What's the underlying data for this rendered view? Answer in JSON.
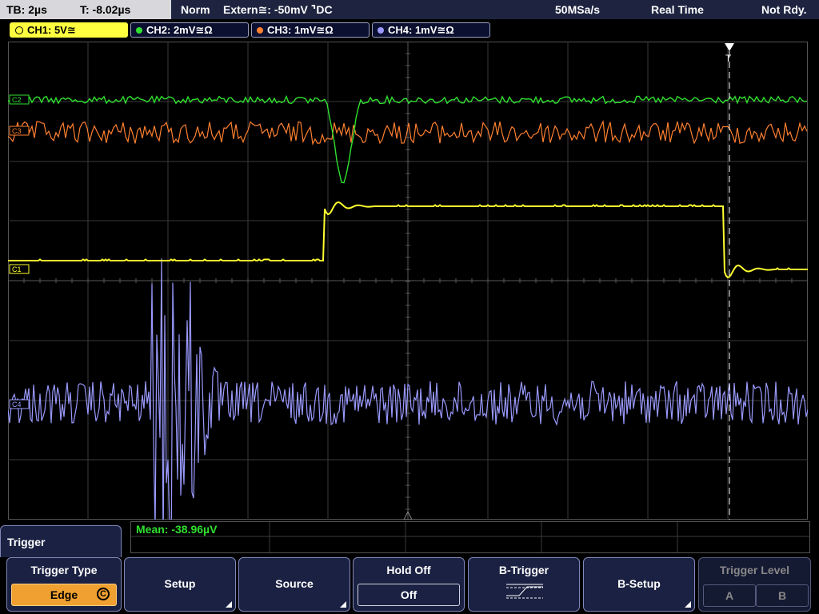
{
  "topbar": {
    "timebase": "TB: 2µs",
    "trigger_time": "T: -8.02µs",
    "mode": "Norm",
    "trigger_source": "Extern≅: -50mV ⌝DC",
    "sample_rate": "50MSa/s",
    "acq_mode": "Real Time",
    "status": "Not Rdy."
  },
  "channels": [
    {
      "label": "CH1: 5V≅",
      "color": "#ffff40"
    },
    {
      "label": "CH2: 2mV≅Ω",
      "color": "#30e030"
    },
    {
      "label": "CH3: 1mV≅Ω",
      "color": "#ff8030"
    },
    {
      "label": "CH4: 1mV≅Ω",
      "color": "#9a9aff"
    }
  ],
  "markers": {
    "c1": "C1",
    "c2": "C2",
    "c3": "C3",
    "c4": "C4",
    "trigger": "T"
  },
  "measurement": {
    "mean": "Mean: -38.96µV"
  },
  "menu": {
    "title": "Trigger",
    "softkeys": {
      "trigger_type": {
        "label": "Trigger Type",
        "value": "Edge",
        "mark": "C"
      },
      "setup": {
        "label": "Setup"
      },
      "source": {
        "label": "Source"
      },
      "hold_off": {
        "label": "Hold Off",
        "value": "Off"
      },
      "b_trigger": {
        "label": "B-Trigger"
      },
      "b_setup": {
        "label": "B-Setup"
      },
      "trigger_level": {
        "label": "Trigger Level",
        "a": "A",
        "b": "B"
      }
    }
  }
}
